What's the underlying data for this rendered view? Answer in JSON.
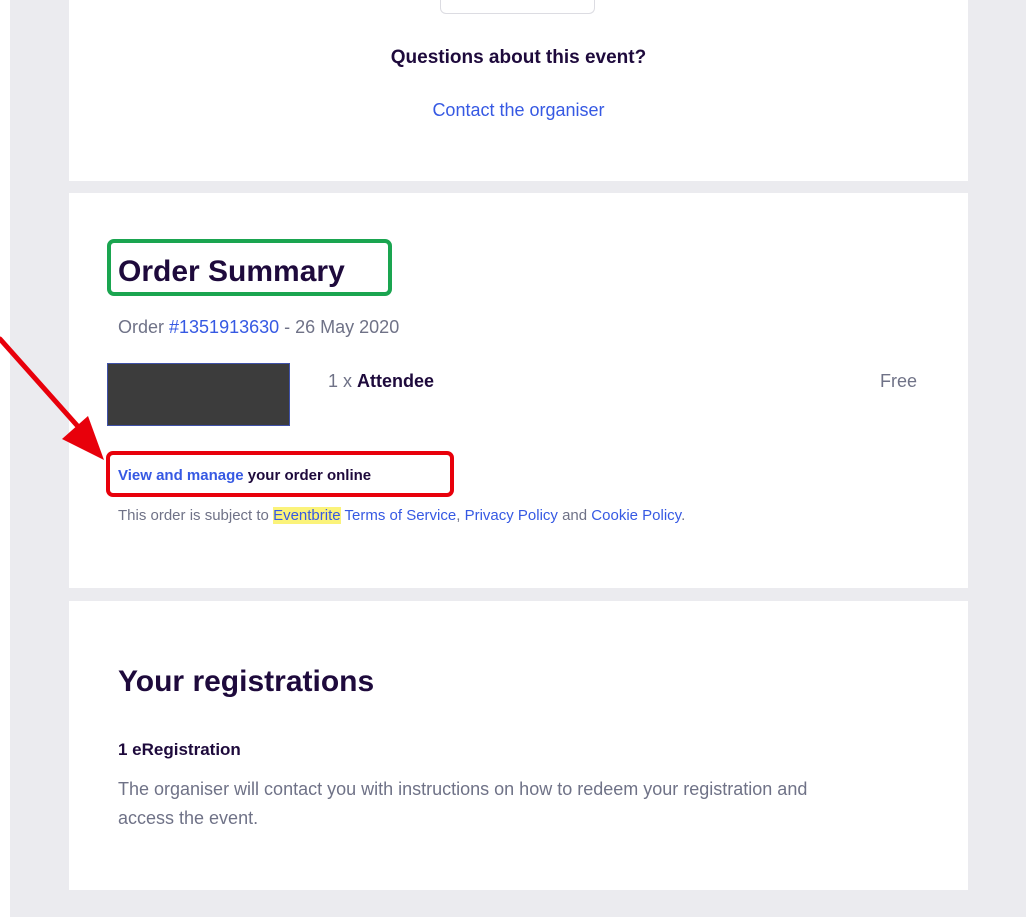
{
  "questions_card": {
    "title": "Questions about this event?",
    "contact_link": "Contact the organiser"
  },
  "order_summary": {
    "title": "Order Summary",
    "order_prefix": "Order ",
    "order_number": "#1351913630",
    "order_date": " - 26 May 2020",
    "ticket": {
      "quantity": "1 x ",
      "type": "Attendee",
      "price": "Free"
    },
    "manage_link": "View and manage",
    "manage_suffix": " your order online",
    "terms": {
      "prefix": "This order is subject to ",
      "brand": "Eventbrite",
      "terms_link": "Terms of Service",
      "comma": ", ",
      "privacy_link": "Privacy Policy",
      "and": " and ",
      "cookie_link": "Cookie Policy",
      "period": "."
    }
  },
  "registrations": {
    "title": "Your registrations",
    "count_label": "1 eRegistration",
    "description": "The organiser will contact you with instructions on how to redeem your registration and access the event."
  },
  "annotation_colors": {
    "highlight_box_green": "#1aa550",
    "highlight_box_red": "#e8000b",
    "arrow": "#e8000b"
  }
}
